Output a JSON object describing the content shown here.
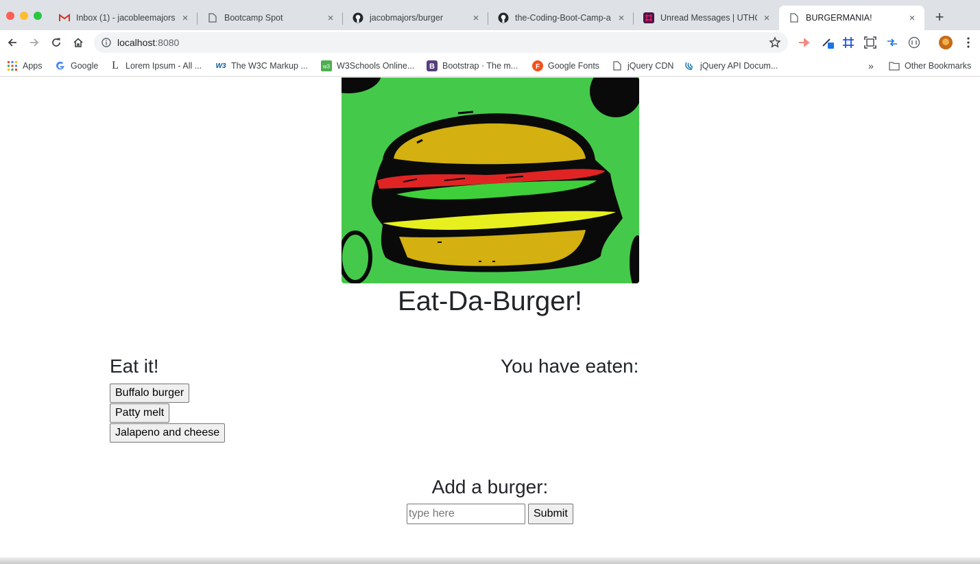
{
  "browser": {
    "tabs": [
      {
        "title": "Inbox (1) - jacobleemajors",
        "icon": "gmail-icon"
      },
      {
        "title": "Bootcamp Spot",
        "icon": "page-icon"
      },
      {
        "title": "jacobmajors/burger",
        "icon": "github-icon"
      },
      {
        "title": "the-Coding-Boot-Camp-a",
        "icon": "github-icon"
      },
      {
        "title": "Unread Messages | UTHO",
        "icon": "slack-icon"
      },
      {
        "title": "BURGERMANIA!",
        "icon": "page-icon",
        "active": true
      }
    ],
    "address": {
      "host": "localhost",
      "port": ":8080"
    },
    "bookmarks": [
      {
        "label": "Apps",
        "icon": "apps-grid-icon"
      },
      {
        "label": "Google",
        "icon": "google-icon"
      },
      {
        "label": "Lorem Ipsum - All ...",
        "icon": "lorem-ipsum-icon"
      },
      {
        "label": "The W3C Markup ...",
        "icon": "w3c-icon"
      },
      {
        "label": "W3Schools Online...",
        "icon": "w3schools-icon"
      },
      {
        "label": "Bootstrap · The m...",
        "icon": "bootstrap-icon"
      },
      {
        "label": "Google Fonts",
        "icon": "google-fonts-icon"
      },
      {
        "label": "jQuery CDN",
        "icon": "page-icon"
      },
      {
        "label": "jQuery API Docum...",
        "icon": "jquery-icon"
      }
    ],
    "overflow_label": "»",
    "other_bookmarks": "Other Bookmarks"
  },
  "page": {
    "title": "Eat-Da-Burger!",
    "eat_heading": "Eat it!",
    "eaten_heading": "You have eaten:",
    "burgers": [
      "Buffalo burger",
      "Patty melt",
      "Jalapeno and cheese"
    ],
    "eaten": [],
    "add_heading": "Add a burger:",
    "input_placeholder": "type here",
    "input_value": "",
    "submit_label": "Submit"
  },
  "colors": {
    "hero_bg": "#45c94a",
    "bun": "#d4b010",
    "tomato": "#e02424",
    "lettuce": "#3fcf3a",
    "cheese": "#e7f01e"
  }
}
